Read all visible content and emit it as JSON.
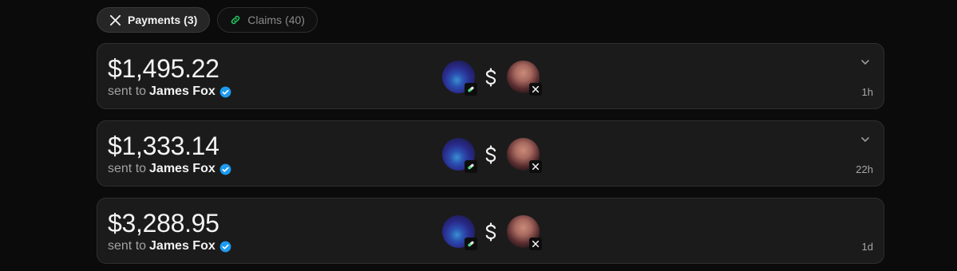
{
  "tabs": [
    {
      "label": "Payments",
      "count": "(3)",
      "icon": "x-logo-icon",
      "active": true
    },
    {
      "label": "Claims",
      "count": "(40)",
      "icon": "link-icon",
      "active": false
    }
  ],
  "payments": [
    {
      "amount": "$1,495.22",
      "sent_prefix": "sent to",
      "recipient": "James Fox",
      "verified": true,
      "time": "1h",
      "expandable": true
    },
    {
      "amount": "$1,333.14",
      "sent_prefix": "sent to",
      "recipient": "James Fox",
      "verified": true,
      "time": "22h",
      "expandable": true
    },
    {
      "amount": "$3,288.95",
      "sent_prefix": "sent to",
      "recipient": "James Fox",
      "verified": true,
      "time": "1d",
      "expandable": false
    }
  ],
  "colors": {
    "background": "#0b0b0b",
    "card": "#1b1b1b",
    "verified_blue": "#1d9bf0",
    "link_green": "#22c55e"
  }
}
